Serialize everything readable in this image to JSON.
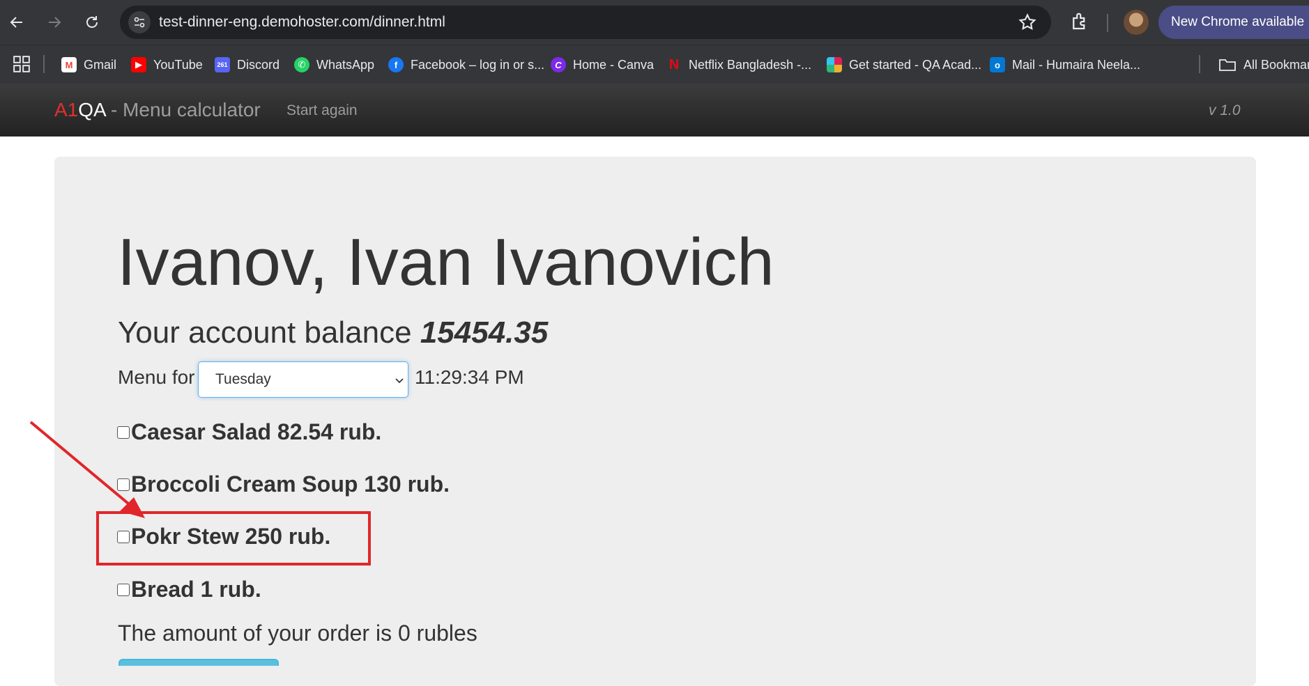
{
  "browser": {
    "url": "test-dinner-eng.demohoster.com/dinner.html",
    "update_label": "New Chrome available",
    "bookmarks": [
      {
        "label": "Gmail",
        "icon": "gmail-icon",
        "color": "#ea4335"
      },
      {
        "label": "YouTube",
        "icon": "youtube-icon",
        "color": "#ff0000"
      },
      {
        "label": "Discord",
        "icon": "discord-icon",
        "color": "#5865f2",
        "badge": "261"
      },
      {
        "label": "WhatsApp",
        "icon": "whatsapp-icon",
        "color": "#25d366"
      },
      {
        "label": "Facebook – log in or s...",
        "icon": "facebook-icon",
        "color": "#1877f2"
      },
      {
        "label": "Home - Canva",
        "icon": "canva-icon",
        "color": "#7d2ae8"
      },
      {
        "label": "Netflix Bangladesh -...",
        "icon": "netflix-icon",
        "color": "#e50914"
      },
      {
        "label": "Get started - QA Acad...",
        "icon": "slack-icon",
        "color": "#e01e5a"
      },
      {
        "label": "Mail - Humaira Neela...",
        "icon": "outlook-icon",
        "color": "#0078d4"
      }
    ],
    "all_bookmarks_label": "All Bookmarks"
  },
  "navbar": {
    "brand_a1": "A1",
    "brand_qa": "QA",
    "brand_rest": " - Menu calculator",
    "start_again": "Start again",
    "version": "v 1.0"
  },
  "main": {
    "name": "Ivanov, Ivan Ivanovich",
    "balance_label": "Your account balance ",
    "balance_value": "15454.35",
    "menu_for_label": "Menu for",
    "selected_day": "Tuesday",
    "time": "11:29:34 PM",
    "dishes": [
      {
        "label": "Caesar Salad 82.54 rub.",
        "checked": false
      },
      {
        "label": "Broccoli Cream Soup 130 rub.",
        "checked": false
      },
      {
        "label": "Pokr Stew 250 rub.",
        "checked": false,
        "highlighted": true
      },
      {
        "label": "Bread 1 rub.",
        "checked": false
      }
    ],
    "total_text": "The amount of your order is 0 rubles"
  },
  "colors": {
    "annotation_red": "#e0262b",
    "brand_red": "#e03030",
    "jumbotron": "#eeeeee"
  }
}
